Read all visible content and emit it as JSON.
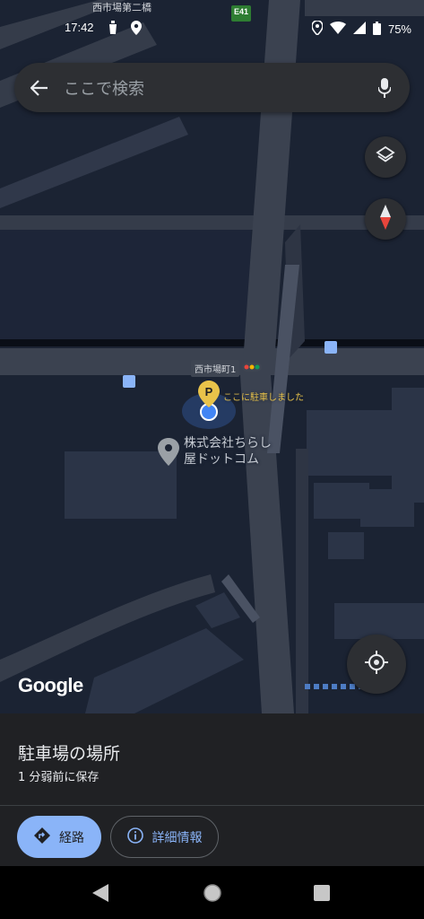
{
  "status_bar": {
    "time": "17:42",
    "battery": "75%",
    "icons": [
      "notification-icon",
      "location-icon",
      "location-icon",
      "wifi-icon",
      "signal-icon",
      "battery-icon"
    ]
  },
  "search": {
    "placeholder": "ここで検索"
  },
  "map": {
    "road_labels": {
      "bridge": "西市場第二橋",
      "highway_shield": "E41",
      "street": "西市場町1"
    },
    "pin_label": "ここに駐車しました",
    "place_name_line1": "株式会社ちらし",
    "place_name_line2": "屋ドットコム",
    "logo_text": "Google"
  },
  "sheet": {
    "title": "駐車場の場所",
    "subtitle": "1 分弱前に保存",
    "route_label": "経路",
    "details_label": "詳細情報"
  },
  "colors": {
    "accent": "#8ab4f8",
    "parking_pin": "#e9c34a",
    "location_dot": "#4285f4"
  }
}
